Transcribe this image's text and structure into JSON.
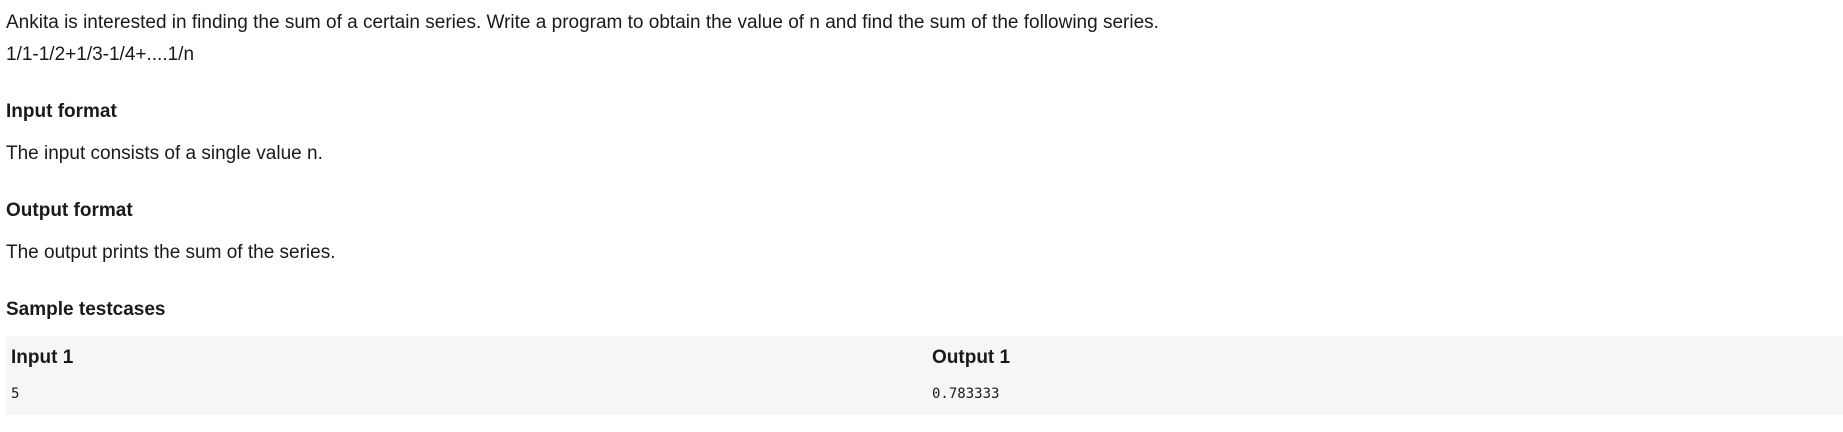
{
  "problem": {
    "statement": "Ankita is interested in finding the sum of a certain series. Write a program to obtain the value of n and find the sum of the following series.",
    "series": "1/1-1/2+1/3-1/4+....1/n"
  },
  "input_format": {
    "heading": "Input format",
    "text": "The input consists of a single value n."
  },
  "output_format": {
    "heading": "Output format",
    "text": "The output prints the sum of the series."
  },
  "sample": {
    "heading": "Sample testcases",
    "input_label": "Input 1",
    "output_label": "Output 1",
    "input_value": "5",
    "output_value": "0.783333"
  }
}
